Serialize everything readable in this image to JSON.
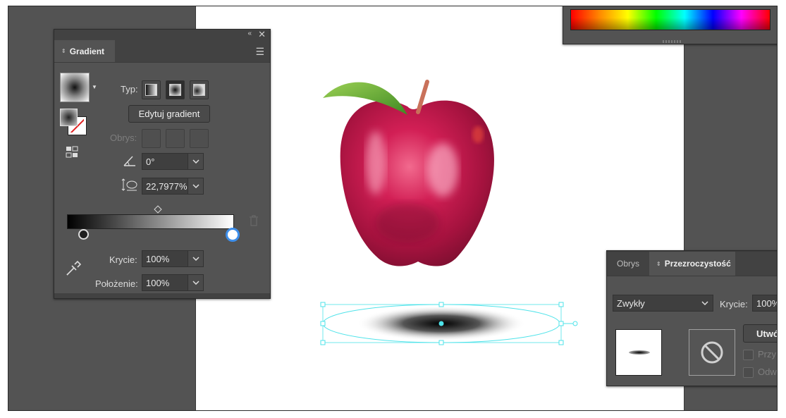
{
  "gradient_panel": {
    "tab_label": "Gradient",
    "type_label": "Typ:",
    "edit_button_label": "Edytuj gradient",
    "stroke_label": "Obrys:",
    "angle_value": "0°",
    "aspect_value": "22,7977%",
    "opacity_label": "Krycie:",
    "opacity_value": "100%",
    "location_label": "Położenie:",
    "location_value": "100%",
    "gradient_start_color": "#000000",
    "gradient_end_color": "#ffffff"
  },
  "transparency_panel": {
    "tabs": [
      {
        "label": "Obrys"
      },
      {
        "label": "Przezroczystość"
      }
    ],
    "blend_mode": "Zwykły",
    "opacity_label": "Krycie:",
    "opacity_value": "100%",
    "make_mask_label": "Utwó",
    "clip_label": "Przy",
    "invert_label": "Odw"
  },
  "colors": {
    "panel_bg": "#535353",
    "app_bg": "#535353",
    "selection": "#4ee3ea",
    "apple_red": "#c8174a",
    "leaf_green": "#5a9e2f"
  },
  "icons": [
    "collapse-icon",
    "close-icon",
    "menu-icon",
    "linear-gradient-icon",
    "radial-gradient-icon",
    "freeform-gradient-icon",
    "angle-icon",
    "aspect-ratio-icon",
    "eyedropper-icon",
    "trash-icon",
    "no-mask-icon",
    "reverse-gradient-icon"
  ]
}
